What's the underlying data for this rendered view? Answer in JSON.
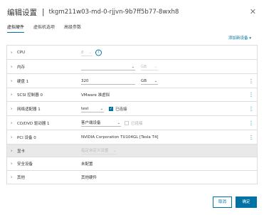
{
  "header": {
    "title": "编辑设置",
    "separator": "|",
    "vm_name": "tkgm211w03-md-0-rjjvn-9b7ff5b77-8wxh8",
    "close_icon": "close-icon"
  },
  "tabs": [
    {
      "label": "虚拟硬件",
      "active": true
    },
    {
      "label": "虚拟机选项",
      "active": false
    },
    {
      "label": "高级参数",
      "active": false
    }
  ],
  "add_device_label": "添加新设备 ▾",
  "rows": {
    "cpu": {
      "label": "CPU",
      "value": "8",
      "info_icon": "info-icon"
    },
    "memory": {
      "label": "内存",
      "value": "",
      "unit": "GB"
    },
    "disk": {
      "label": "硬盘 1",
      "value": "320",
      "unit": "GB"
    },
    "scsi": {
      "label": "SCSI 控制器 0",
      "value": "VMware 准虚拟"
    },
    "network": {
      "label": "网络适配器 1",
      "value": "test",
      "connected_label": "已连接",
      "connected": true
    },
    "cdrom": {
      "label": "CD/DVD 驱动器 1",
      "value": "客户端设备",
      "connected_label": "已连接",
      "connected": false
    },
    "pci": {
      "label": "PCI 设备 0",
      "value": "NVIDIA Corporation TU104GL [Tesla T4]"
    },
    "video": {
      "label": "显卡",
      "value": "指定自定义设置"
    },
    "security": {
      "label": "安全设备",
      "value": "未配置"
    },
    "other": {
      "label": "其他",
      "value": "其他硬件"
    }
  },
  "buttons": {
    "cancel": "取消",
    "ok": "确定"
  },
  "colors": {
    "accent": "#0072a3",
    "row_shaded": "#e9e9e9"
  }
}
